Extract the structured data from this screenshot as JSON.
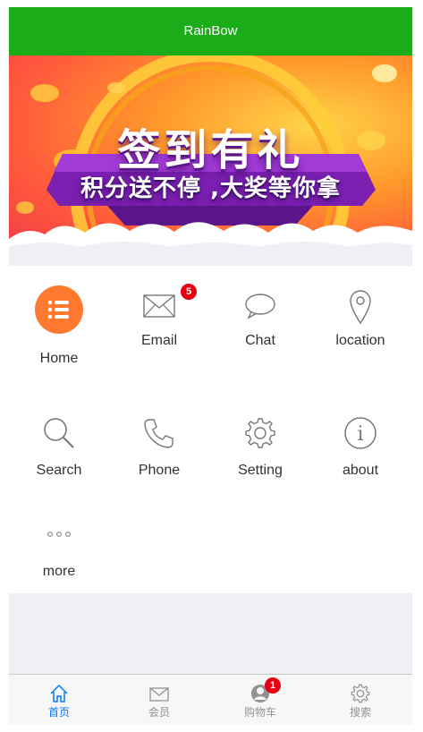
{
  "header": {
    "title": "RainBow"
  },
  "banner": {
    "title": "签到有礼",
    "subtitle": "积分送不停 ,大奖等你拿",
    "slide_count": 2
  },
  "menu": {
    "items": [
      {
        "label": "Home",
        "icon": "list-icon"
      },
      {
        "label": "Email",
        "icon": "envelope-icon",
        "badge": "5"
      },
      {
        "label": "Chat",
        "icon": "chat-bubble-icon"
      },
      {
        "label": "location",
        "icon": "location-pin-icon"
      },
      {
        "label": "Search",
        "icon": "search-icon"
      },
      {
        "label": "Phone",
        "icon": "phone-icon"
      },
      {
        "label": "Setting",
        "icon": "gear-icon"
      },
      {
        "label": "about",
        "icon": "info-icon"
      },
      {
        "label": "more",
        "icon": "more-dots-icon"
      }
    ]
  },
  "tabbar": {
    "items": [
      {
        "label": "首页",
        "icon": "home-icon",
        "active": true
      },
      {
        "label": "会员",
        "icon": "envelope-icon"
      },
      {
        "label": "购物车",
        "icon": "user-circle-icon",
        "badge": "1"
      },
      {
        "label": "搜索",
        "icon": "gear-icon"
      }
    ]
  },
  "colors": {
    "header_bg": "#1aad19",
    "home_icon_bg": "#ff7a2f",
    "badge": "#e60012",
    "tab_active": "#007aff",
    "tab_inactive": "#929292"
  }
}
